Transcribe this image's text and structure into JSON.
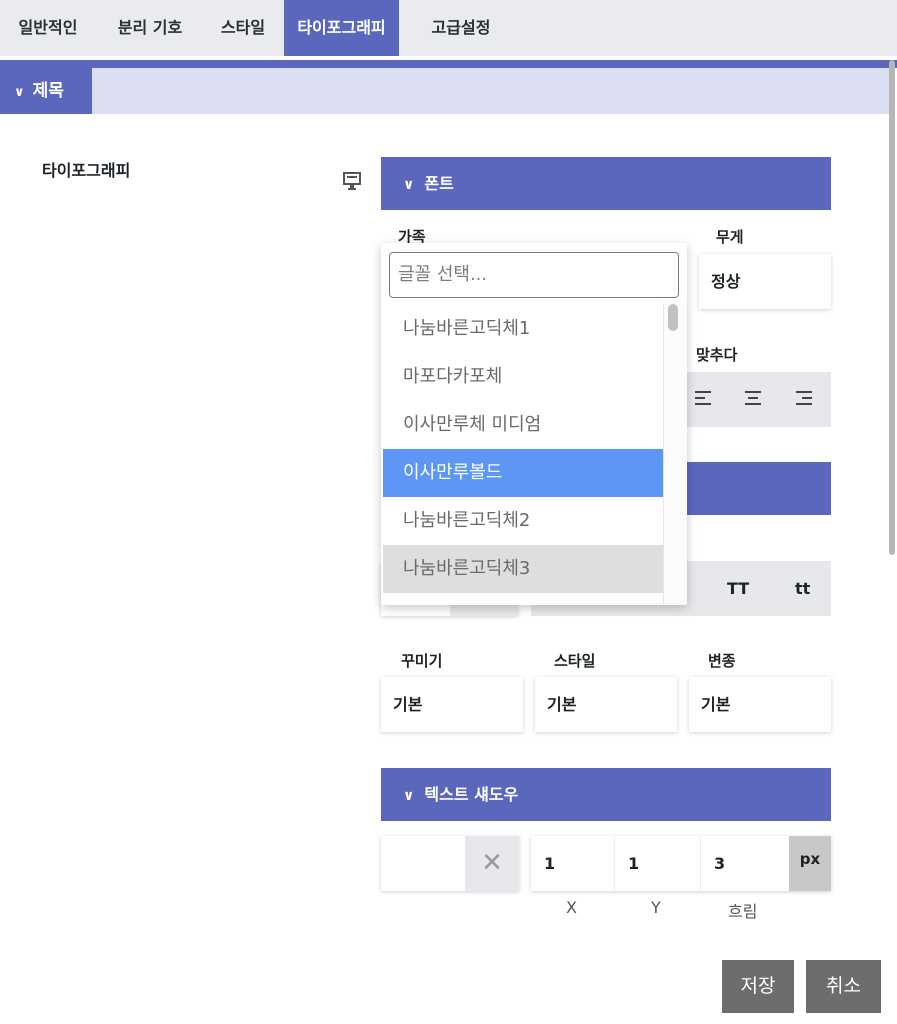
{
  "tabs": [
    "일반적인",
    "분리 기호",
    "스타일",
    "타이포그래피",
    "고급설정"
  ],
  "active_tab": "타이포그래피",
  "section": {
    "title": "제목"
  },
  "typography_label": "타이포그래피",
  "font_panel": {
    "title": "폰트",
    "family_label": "가족",
    "weight_label": "무게",
    "weight_value": "정상",
    "align_label": "맞추다",
    "search_placeholder": "글꼴 선택...",
    "font_options": [
      "나눔바른고딕체1",
      "마포다카포체",
      "이사만루체 미디엄",
      "이사만루볼드",
      "나눔바른고딕체2",
      "나눔바른고딕체3"
    ],
    "selected_option": "이사만루볼드",
    "hover_option": "나눔바른고딕체3"
  },
  "transform": {
    "upper": "TT",
    "lower": "tt"
  },
  "decoration": {
    "decoration_label": "꾸미기",
    "decoration_value": "기본",
    "style_label": "스타일",
    "style_value": "기본",
    "variant_label": "변종",
    "variant_value": "기본"
  },
  "text_shadow": {
    "title": "텍스트 섀도우",
    "x": "1",
    "y": "1",
    "blur": "3",
    "unit": "px",
    "x_label": "X",
    "y_label": "Y",
    "blur_label": "흐림"
  },
  "buttons": {
    "save": "저장",
    "cancel": "취소"
  },
  "colors": {
    "accent": "#5b67bd",
    "section_bg": "#dcdff3",
    "tab_bg": "#e9ebee",
    "selected_option": "#5c97f5",
    "hover_option": "#dedede",
    "button": "#6d6d6d"
  }
}
